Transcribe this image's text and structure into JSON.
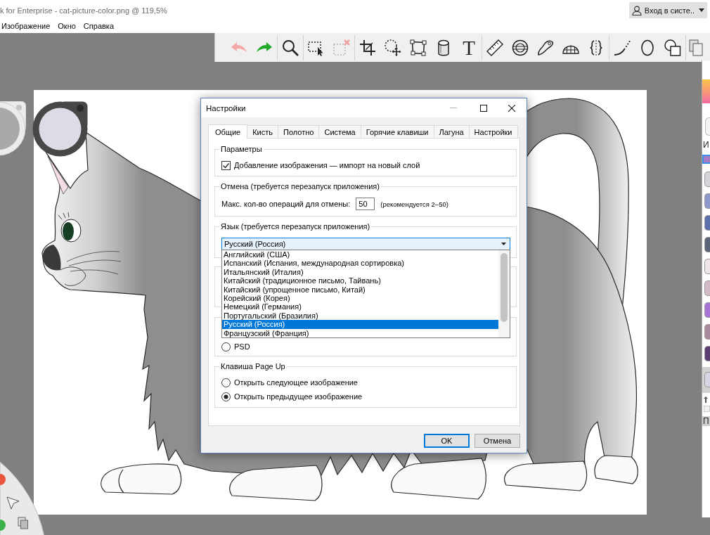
{
  "window": {
    "title": "k for Enterprise - cat-picture-color.png @ 119,5%",
    "account_button": "Вход в систе.."
  },
  "menu": [
    {
      "label": "Изображение"
    },
    {
      "label": "Окно"
    },
    {
      "label": "Справка"
    }
  ],
  "toolbar": {
    "text_tool_label": "T"
  },
  "dialog": {
    "title": "Настройки",
    "tabs": [
      {
        "label": "Общие",
        "selected": true
      },
      {
        "label": "Кисть",
        "selected": false
      },
      {
        "label": "Полотно",
        "selected": false
      },
      {
        "label": "Система",
        "selected": false
      },
      {
        "label": "Горячие клавиши",
        "selected": false
      },
      {
        "label": "Лагуна",
        "selected": false
      },
      {
        "label": "Настройки",
        "selected": false
      }
    ],
    "groups": [
      {
        "kind": "frame",
        "legend": "Параметры",
        "items": [
          {
            "kind": "checkbox",
            "label": "Добавление изображения — импорт на новый слой",
            "checked": true
          }
        ]
      },
      {
        "kind": "frame",
        "legend": "Отмена (требуется перезапуск приложения)",
        "items": [
          {
            "kind": "number",
            "label": "Макс. кол-во операций для отмены:",
            "value": "50",
            "hint": "(рекомендуется 2–50)"
          }
        ]
      },
      {
        "kind": "frame",
        "legend": "Язык (требуется перезапуск приложения)",
        "items": [
          {
            "kind": "dropdown",
            "value": "Русский (Россия)",
            "expanded": true,
            "options": [
              {
                "label": "Английский (США)",
                "selected": false
              },
              {
                "label": "Испанский (Испания, международная сортировка)",
                "selected": false
              },
              {
                "label": "Итальянский (Италия)",
                "selected": false
              },
              {
                "label": "Китайский (традиционное письмо, Тайвань)",
                "selected": false
              },
              {
                "label": "Китайский (упрощенное письмо, Китай)",
                "selected": false
              },
              {
                "label": "Корейский (Корея)",
                "selected": false
              },
              {
                "label": "Немецкий (Германия)",
                "selected": false
              },
              {
                "label": "Португальский (Бразилия)",
                "selected": false
              },
              {
                "label": "Русский (Россия)",
                "selected": true
              },
              {
                "label": "Французский (Франция)",
                "selected": false
              }
            ]
          }
        ]
      },
      {
        "kind": "empty"
      },
      {
        "kind": "frame",
        "items": [
          {
            "kind": "radio",
            "label": "PSD",
            "selected": false
          }
        ]
      },
      {
        "kind": "frame",
        "legend": "Клавиша Page Up",
        "items": [
          {
            "kind": "radio",
            "label": "Открыть следующее изображение",
            "selected": false
          },
          {
            "kind": "radio",
            "label": "Открыть предыдущее изображение",
            "selected": true
          }
        ]
      }
    ],
    "buttons": [
      {
        "label": "OK",
        "default": true
      },
      {
        "label": "Отмена",
        "default": false
      }
    ]
  },
  "right_panel": {
    "labels": [
      "И",
      "П"
    ],
    "swatches": [
      {
        "kind": "current",
        "color": "#a77cc2"
      },
      {
        "kind": "tile",
        "color": "#d4d4d8"
      },
      {
        "kind": "tile",
        "color": "#8f98cc"
      },
      {
        "kind": "tile",
        "color": "#5c70ae"
      },
      {
        "kind": "tile",
        "color": "#5b6479"
      },
      {
        "kind": "tile",
        "color": "#efe6ec"
      },
      {
        "kind": "tile",
        "color": "#d3b9c6"
      },
      {
        "kind": "tile",
        "color": "#a574d6"
      },
      {
        "kind": "tile",
        "color": "#a98a9c"
      },
      {
        "kind": "tile",
        "color": "#5b3f72"
      },
      {
        "kind": "large",
        "color": "#d6d6e6"
      }
    ]
  }
}
